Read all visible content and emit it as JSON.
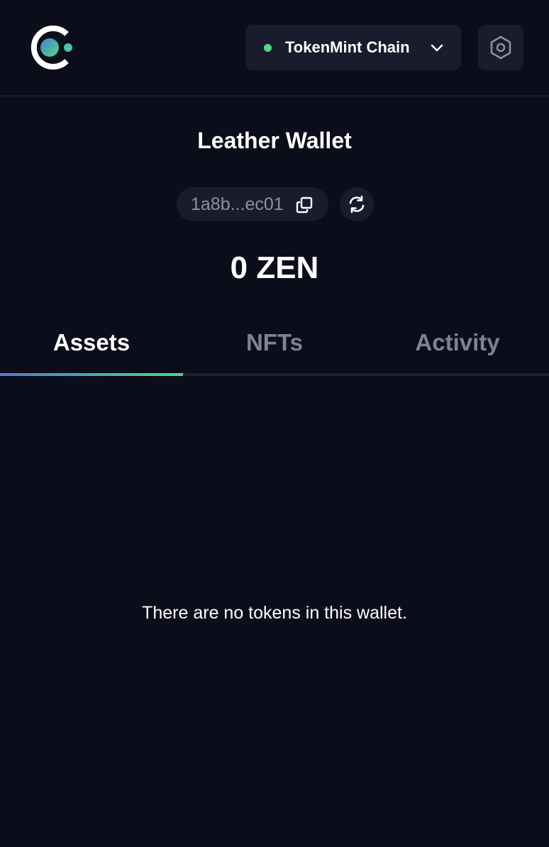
{
  "header": {
    "logo_icon": "app-logo-icon",
    "network": {
      "label": "TokenMint Chain",
      "status_color": "#4fd98a",
      "chevron_icon": "chevron-down-icon"
    },
    "settings_icon": "settings-hexagon-icon"
  },
  "wallet": {
    "name": "Leather Wallet",
    "address_short": "1a8b...ec01",
    "copy_icon": "copy-icon",
    "refresh_icon": "refresh-icon",
    "balance": "0 ZEN"
  },
  "tabs": [
    {
      "label": "Assets",
      "active": true
    },
    {
      "label": "NFTs",
      "active": false
    },
    {
      "label": "Activity",
      "active": false
    }
  ],
  "assets": {
    "empty_message": "There are no tokens in this wallet."
  },
  "colors": {
    "background": "#0c0d1a",
    "surface": "#1a1c2d",
    "accent_gradient_start": "#4a7fd6",
    "accent_gradient_end": "#4fd98a"
  }
}
